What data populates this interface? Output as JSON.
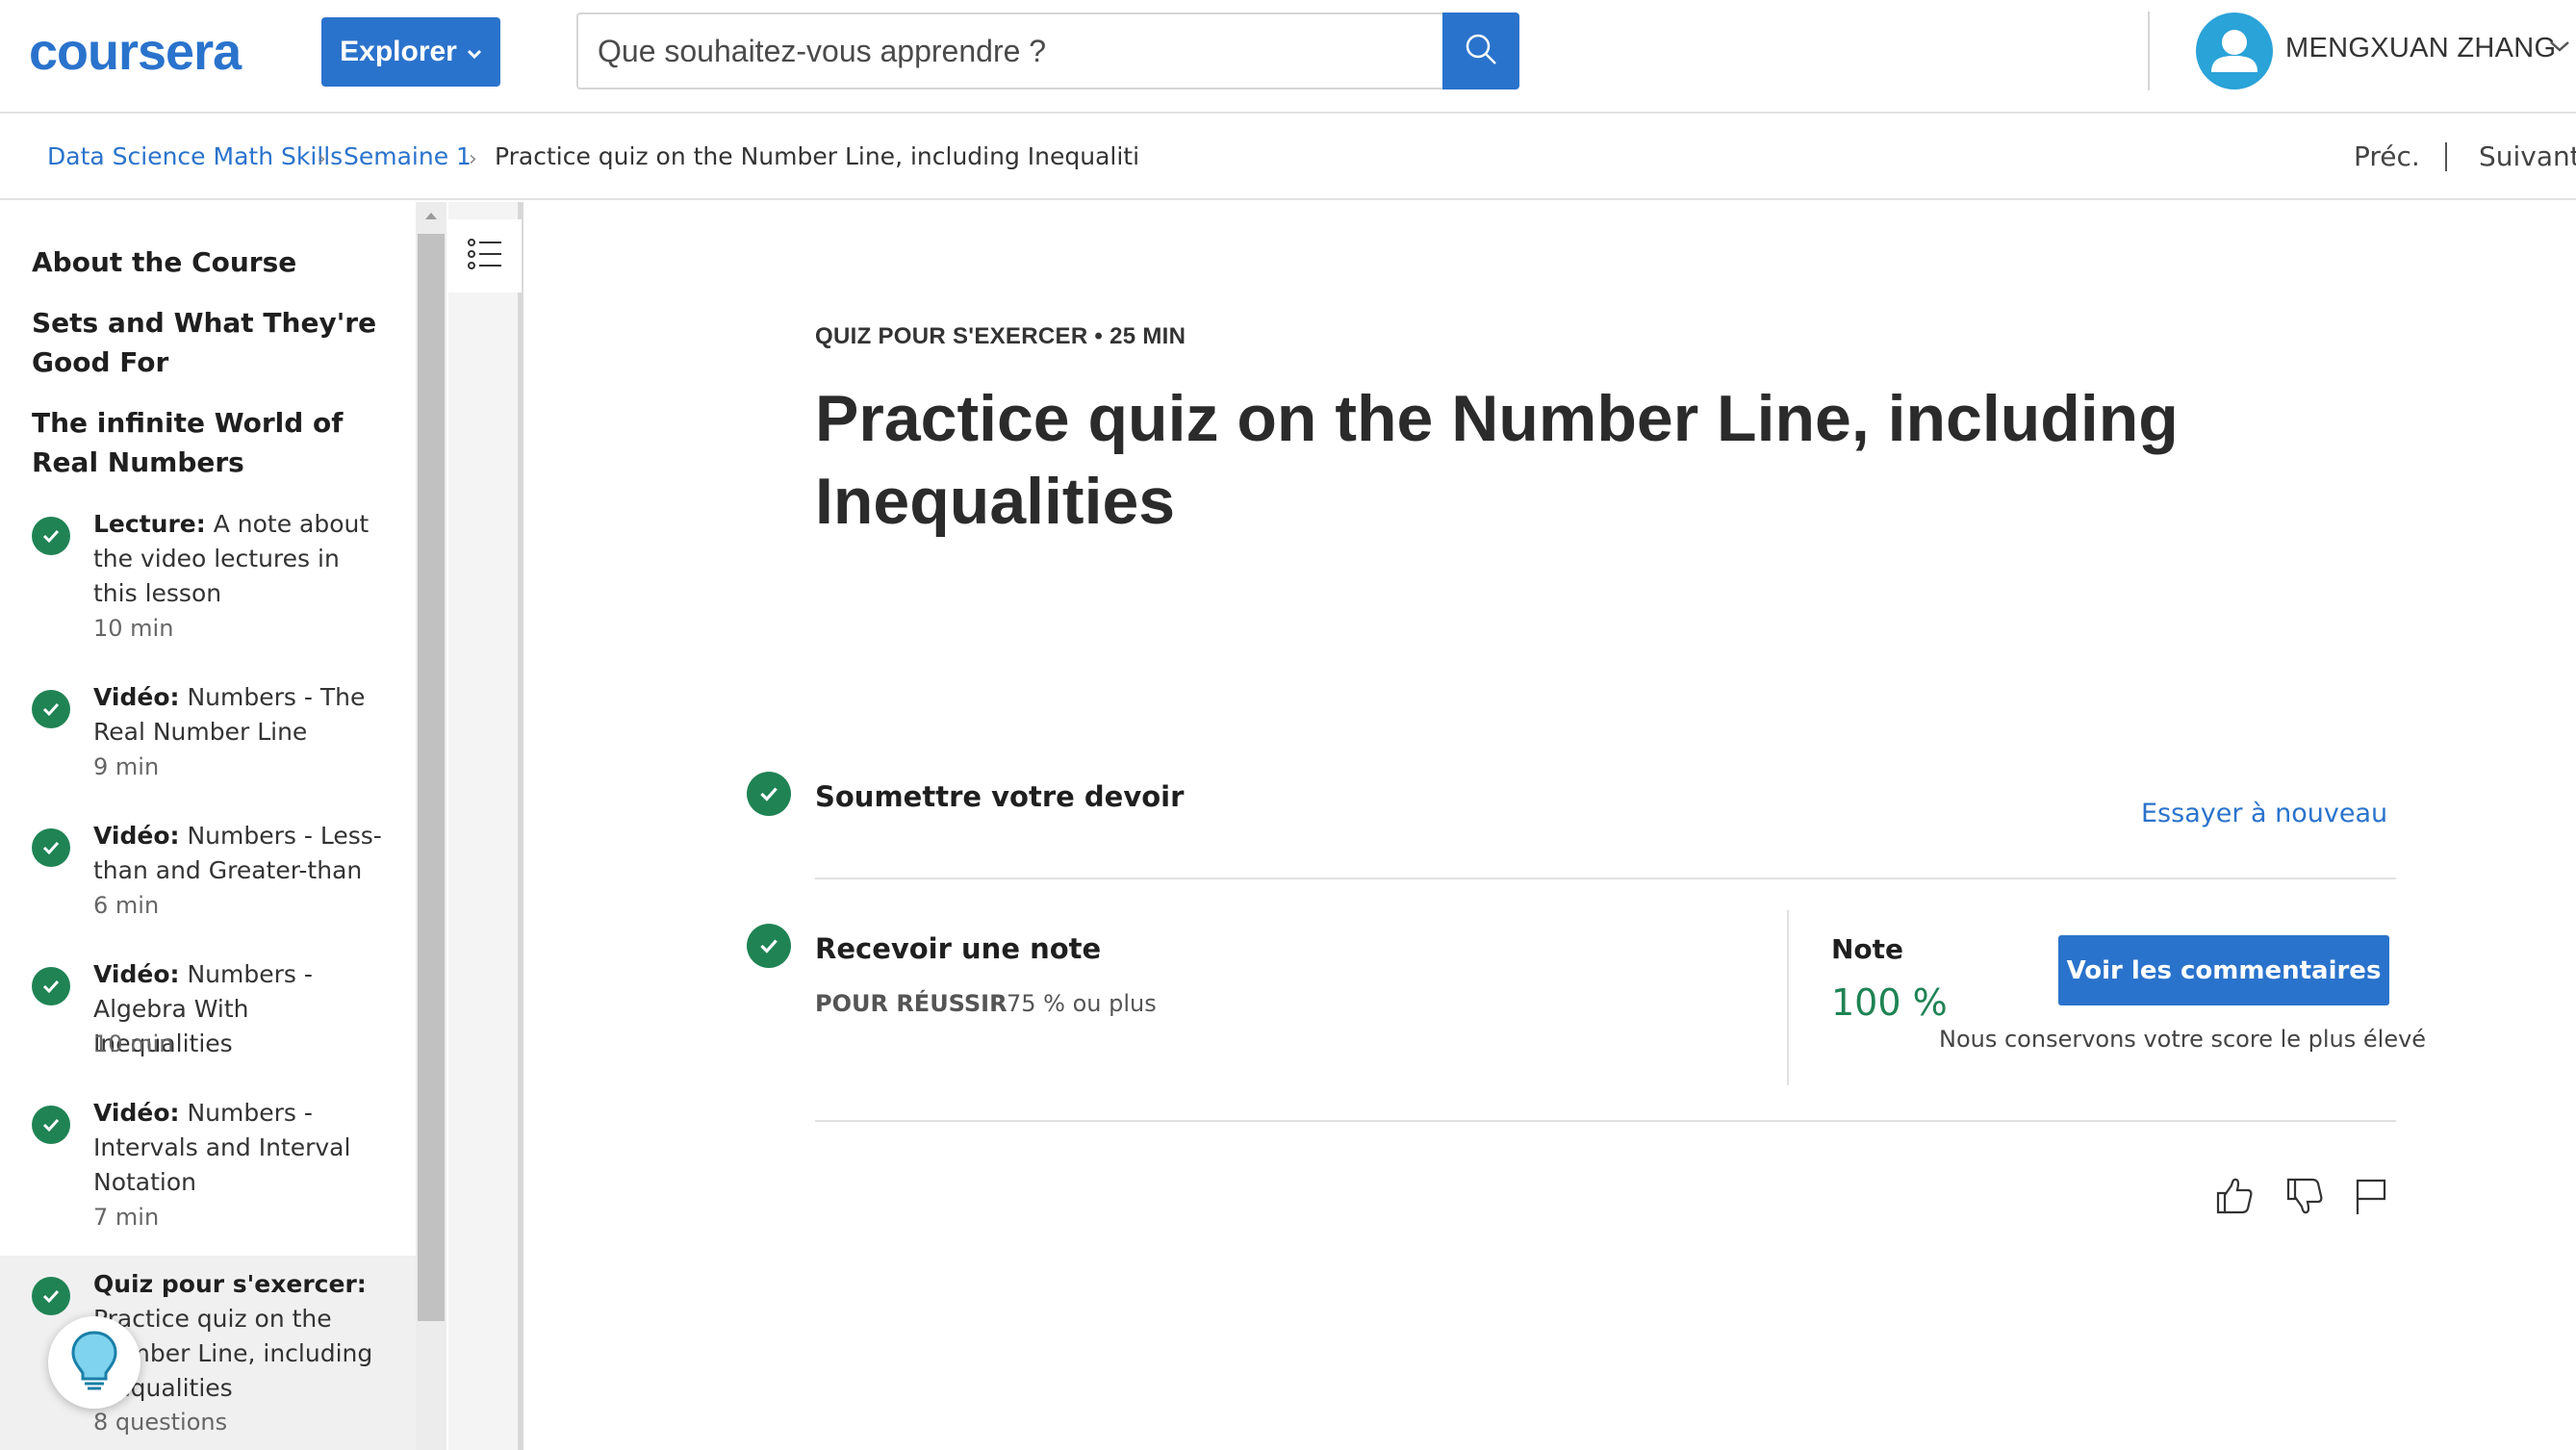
{
  "header": {
    "logo": "coursera",
    "explore_label": "Explorer",
    "search_placeholder": "Que souhaitez-vous apprendre ?",
    "user_name": "MENGXUAN ZHANG",
    "brand_color": "#2a73cc"
  },
  "breadcrumb": {
    "course": "Data Science Math Skills",
    "week": "Semaine 1",
    "current": "Practice quiz on the Number Line, including Inequaliti",
    "prev": "Préc.",
    "next": "Suivant"
  },
  "sidebar": {
    "headings": [
      "About the Course",
      "Sets and What They're Good For",
      "The infinite World of Real Numbers"
    ],
    "lessons": [
      {
        "type": "Lecture:",
        "title": "A note about the video lectures in this lesson",
        "meta": "10  min",
        "completed": true
      },
      {
        "type": "Vidéo:",
        "title": "Numbers - The Real Number Line",
        "meta": "9  min",
        "completed": true
      },
      {
        "type": "Vidéo:",
        "title": "Numbers - Less-than and Greater-than",
        "meta": "6  min",
        "completed": true
      },
      {
        "type": "Vidéo:",
        "title": "Numbers - Algebra With Inequalities",
        "meta": "10  min",
        "completed": true
      },
      {
        "type": "Vidéo:",
        "title": "Numbers - Intervals and Interval Notation",
        "meta": "7  min",
        "completed": true
      },
      {
        "type": "Quiz pour s'exercer:",
        "title": "Practice quiz on the Number Line, including Inequalities",
        "meta": "8 questions",
        "completed": true,
        "active": true
      }
    ]
  },
  "main": {
    "meta": "QUIZ POUR S'EXERCER • 25  MIN",
    "title": "Practice quiz on the Number Line, including Inequalities",
    "submit_title": "Soumettre votre devoir",
    "retry_label": "Essayer à nouveau",
    "grade_title": "Recevoir une note",
    "pass_label": "POUR RÉUSSIR",
    "pass_value": "75 % ou plus",
    "note_label": "Note",
    "note_value": "100 %",
    "feedback_button": "Voir les commentaires",
    "keep_score": "Nous conservons votre score le plus élevé",
    "success_color": "#1f8354"
  },
  "icons": {
    "like": "thumbs-up-icon",
    "dislike": "thumbs-down-icon",
    "flag": "flag-icon",
    "toc": "list-icon",
    "hint": "lightbulb-icon"
  }
}
